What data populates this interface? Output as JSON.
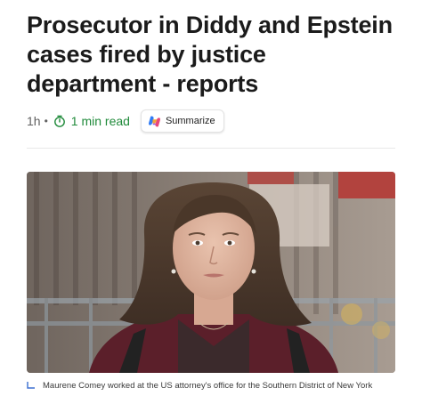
{
  "article": {
    "headline": "Prosecutor in Diddy and Epstein cases fired by justice department - reports",
    "age": "1h",
    "separator": "•",
    "read_time": "1 min read",
    "summarize_label": "Summarize",
    "photo_caption": "Maurene Comey worked at the US attorney's office for the Southern District of New York",
    "photo_alt": "Maurene Comey"
  },
  "icons": {
    "timer": "timer-icon",
    "summarize": "copilot-icon",
    "caption": "caption-corner-icon"
  },
  "colors": {
    "read_time": "#1f8a3a",
    "headline": "#1b1b1b",
    "caption_icon": "#3b6fd1"
  }
}
